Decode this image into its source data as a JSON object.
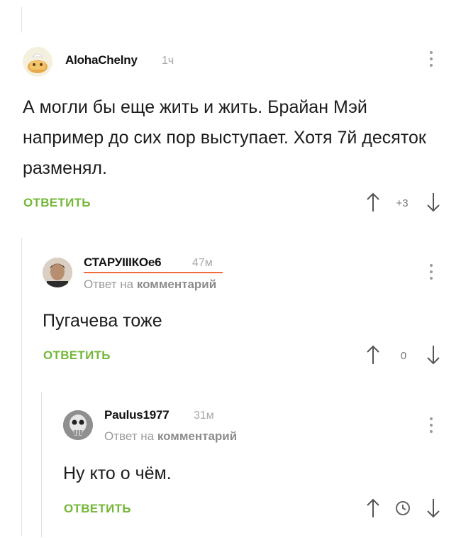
{
  "comments": [
    {
      "username": "AlohaChelny",
      "time": "1ч",
      "text": "А могли бы еще жить и жить. Брайан  Мэй например до сих пор выступает. Хотя 7й десяток разменял.",
      "reply_label": "ОТВЕТИТЬ",
      "rating": "+3",
      "avatar_icon": "cartoon-avatar-icon"
    },
    {
      "username": "СТАРУIIIКОе6",
      "time": "47м",
      "reply_to_prefix": "Ответ на",
      "reply_to_link": "комментарий",
      "text": "Пугачева тоже",
      "reply_label": "ОТВЕТИТЬ",
      "rating": "0",
      "avatar_icon": "person-photo-avatar-icon",
      "accent_underline": "#f26b3a"
    },
    {
      "username": "Paulus1977",
      "time": "31м",
      "reply_to_prefix": "Ответ на",
      "reply_to_link": "комментарий",
      "text": "Ну кто о чём.",
      "reply_label": "ОТВЕТИТЬ",
      "rating_icon": "clock-icon",
      "avatar_icon": "skull-avatar-icon"
    }
  ],
  "colors": {
    "accent_green": "#74b738",
    "thread_line": "#e2e2e2",
    "muted_text": "#9a9a9a"
  },
  "icons": {
    "upvote": "arrow-up-icon",
    "downvote": "arrow-down-icon",
    "menu": "more-vertical-icon"
  }
}
